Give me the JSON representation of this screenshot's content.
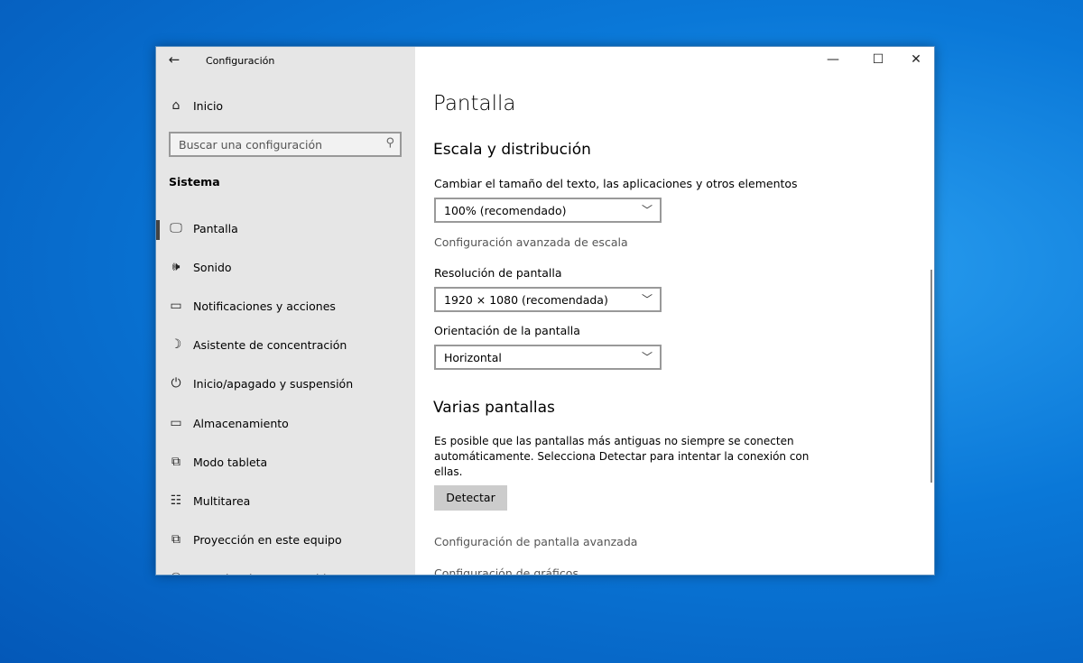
{
  "window": {
    "title": "Configuración",
    "controls": [
      "minimize",
      "maximize",
      "close"
    ]
  },
  "sidebar": {
    "home_label": "Inicio",
    "search_placeholder": "Buscar una configuración",
    "section": "Sistema",
    "items": [
      {
        "label": "Pantalla",
        "icon": "monitor-icon",
        "selected": true
      },
      {
        "label": "Sonido",
        "icon": "speaker-icon"
      },
      {
        "label": "Notificaciones y acciones",
        "icon": "notification-icon"
      },
      {
        "label": "Asistente de concentración",
        "icon": "moon-icon"
      },
      {
        "label": "Inicio/apagado y suspensión",
        "icon": "power-icon"
      },
      {
        "label": "Almacenamiento",
        "icon": "storage-icon"
      },
      {
        "label": "Modo tableta",
        "icon": "tablet-icon"
      },
      {
        "label": "Multitarea",
        "icon": "multitask-icon"
      },
      {
        "label": "Proyección en este equipo",
        "icon": "projection-icon"
      },
      {
        "label": "Experiencias compartidas",
        "icon": "shared-icon"
      }
    ]
  },
  "main": {
    "title": "Pantalla",
    "scale_heading": "Escala y distribución",
    "scale_label": "Cambiar el tamaño del texto, las aplicaciones y otros elementos",
    "scale_value": "100% (recomendado)",
    "scale_link": "Configuración avanzada de escala",
    "resolution_label": "Resolución de pantalla",
    "resolution_value": "1920 × 1080 (recomendada)",
    "orientation_label": "Orientación de la pantalla",
    "orientation_value": "Horizontal",
    "multi_heading": "Varias pantallas",
    "multi_text_1": "Es posible que las pantallas más antiguas no siempre se conecten",
    "multi_text_2": "automáticamente. Selecciona Detectar para intentar la conexión con",
    "multi_text_3": "ellas.",
    "detect_label": "Detectar",
    "advanced_link": "Configuración de pantalla avanzada",
    "graphics_link": "Configuración de gráficos"
  }
}
